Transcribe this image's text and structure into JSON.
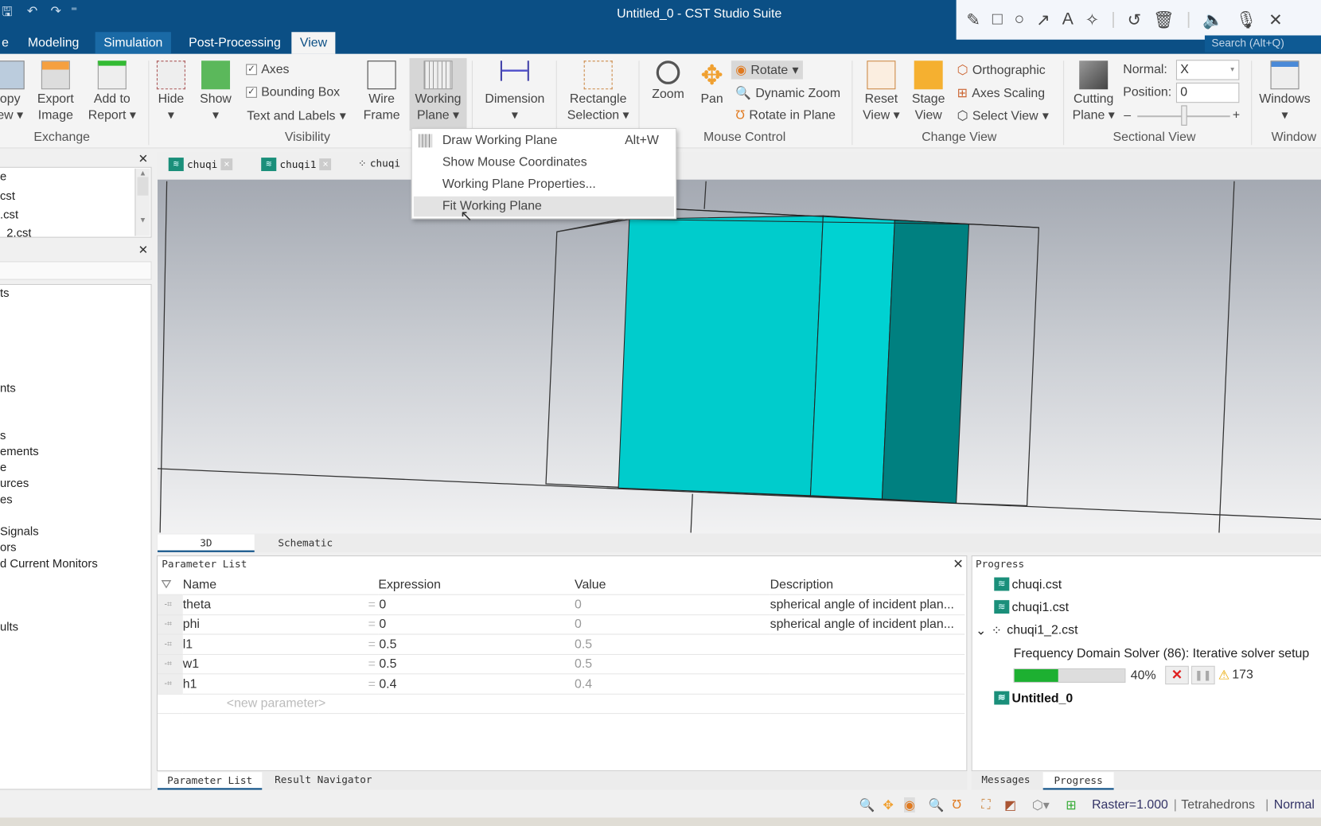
{
  "window": {
    "title": "Untitled_0 - CST Studio Suite",
    "search_placeholder": "Search (Alt+Q)"
  },
  "quick_access": {
    "undo": "↶",
    "redo": "↷",
    "more": "⁼"
  },
  "tabs": [
    {
      "label": "e"
    },
    {
      "label": "Modeling"
    },
    {
      "label": "Simulation"
    },
    {
      "label": "Post-Processing"
    },
    {
      "label": "View"
    }
  ],
  "annotation_toolbar": [
    "pencil-icon",
    "rectangle-icon",
    "circle-icon",
    "arrow-icon",
    "text-icon",
    "magic-wand-icon",
    "undo-icon",
    "trash-icon",
    "speaker-icon",
    "microphone-icon",
    "close-icon"
  ],
  "ribbon": {
    "exchange": {
      "label": "Exchange",
      "copy_view": "opy",
      "copy_view2": "ew",
      "export_image": "Export",
      "export_image2": "Image",
      "add_report": "Add to",
      "add_report2": "Report"
    },
    "visibility": {
      "label": "Visibility",
      "hide": "Hide",
      "show": "Show",
      "axes": "Axes",
      "axes_checked": true,
      "bounding_box": "Bounding Box",
      "bounding_box_checked": true,
      "text_labels": "Text and Labels",
      "wire": "Wire",
      "frame": "Frame",
      "working": "Working",
      "plane": "Plane"
    },
    "dimension": "Dimension",
    "rect_sel": {
      "l1": "Rectangle",
      "l2": "Selection"
    },
    "mouse": {
      "label": "Mouse Control",
      "zoom": "Zoom",
      "pan": "Pan",
      "rotate": "Rotate",
      "dynamic_zoom": "Dynamic Zoom",
      "rotate_plane": "Rotate in Plane"
    },
    "change_view": {
      "label": "Change View",
      "reset": "Reset",
      "reset2": "View",
      "stage": "Stage",
      "stage2": "View",
      "orthographic": "Orthographic",
      "axes_scaling": "Axes Scaling",
      "select_view": "Select View"
    },
    "sectional": {
      "label": "Sectional View",
      "cutting": "Cutting",
      "cutting2": "Plane",
      "normal_label": "Normal:",
      "normal_value": "X",
      "position_label": "Position:",
      "position_value": "0",
      "minus": "–",
      "plus": "+"
    },
    "window": {
      "label": "Window",
      "windows": "Windows"
    }
  },
  "working_plane_menu": [
    {
      "label": "Draw Working Plane",
      "shortcut": "Alt+W"
    },
    {
      "label": "Show Mouse Coordinates"
    },
    {
      "label": "Working Plane Properties..."
    },
    {
      "label": "Fit Working Plane",
      "highlighted": true
    }
  ],
  "left_top_list": [
    "e",
    "cst",
    ".cst",
    "_2.cst"
  ],
  "left_tree": [
    "ts",
    "nts",
    "s",
    "ements",
    "e",
    "urces",
    "es",
    "Signals",
    "ors",
    "d Current Monitors",
    "ults"
  ],
  "doc_tabs": [
    "chuqi",
    "chuqi1",
    "chuqi"
  ],
  "view_tabs": [
    "3D",
    "Schematic"
  ],
  "parameter_list": {
    "title": "Parameter List",
    "columns": [
      "Name",
      "Expression",
      "Value",
      "Description"
    ],
    "rows": [
      {
        "name": "theta",
        "expr": "0",
        "value": "0",
        "desc": "spherical angle of incident plan..."
      },
      {
        "name": "phi",
        "expr": "0",
        "value": "0",
        "desc": "spherical angle of incident plan..."
      },
      {
        "name": "l1",
        "expr": "0.5",
        "value": "0.5",
        "desc": ""
      },
      {
        "name": "w1",
        "expr": "0.5",
        "value": "0.5",
        "desc": ""
      },
      {
        "name": "h1",
        "expr": "0.4",
        "value": "0.4",
        "desc": ""
      }
    ],
    "new_param": "<new parameter>",
    "eq": "="
  },
  "bottom_tabs": [
    "Parameter List",
    "Result Navigator"
  ],
  "progress": {
    "title": "Progress",
    "items": [
      "chuqi.cst",
      "chuqi1.cst",
      "chuqi1_2.cst"
    ],
    "task": "Frequency Domain Solver (86): Iterative solver setup",
    "percent": 40,
    "percent_label": "40%",
    "warnings": "173",
    "current": "Untitled_0",
    "color": "#1db031"
  },
  "right_tabs": [
    "Messages",
    "Progress"
  ],
  "statusbar": {
    "raster": "Raster=1.000",
    "mesh": "Tetrahedrons",
    "mode": "Normal"
  },
  "colors": {
    "title_bar": "#0b4f85",
    "solid_cyan": "#00cccc",
    "solid_teal": "#008080"
  }
}
